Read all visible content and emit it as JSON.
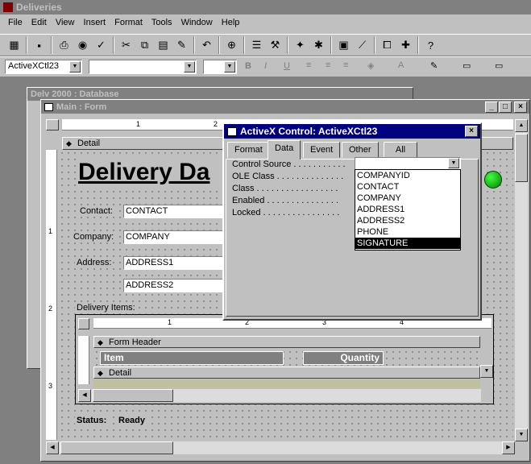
{
  "app": {
    "title": "Deliveries"
  },
  "menu": [
    "File",
    "Edit",
    "View",
    "Insert",
    "Format",
    "Tools",
    "Window",
    "Help"
  ],
  "format_bar": {
    "object_combo": "ActiveXCtl23",
    "font_combo": "",
    "size_combo": ""
  },
  "toolbar_icons": [
    "form-view-icon",
    "save-icon",
    "print-icon",
    "print-preview-icon",
    "spelling-icon",
    "cut-icon",
    "copy-icon",
    "paste-icon",
    "format-painter-icon",
    "undo-icon",
    "insert-hyperlink-icon",
    "field-list-icon",
    "toolbox-icon",
    "autoformat-icon",
    "code-icon",
    "properties-icon",
    "build-icon",
    "database-window-icon",
    "new-object-icon",
    "help-icon"
  ],
  "back_window": {
    "title": "Delv 2000 : Database"
  },
  "form_window": {
    "title": "Main : Form"
  },
  "form": {
    "detail_label": "Detail",
    "heading": "Delivery Da",
    "contact_label": "Contact:",
    "contact_field": "CONTACT",
    "company_label": "Company:",
    "company_field": "COMPANY",
    "address_label": "Address:",
    "address1_field": "ADDRESS1",
    "address2_field": "ADDRESS2",
    "delivery_items_label": "Delivery Items:",
    "sub_form_header_label": "Form Header",
    "sub_item_header": "Item",
    "sub_quantity_header": "Quantity",
    "sub_detail_label": "Detail",
    "status_label": "Status:",
    "status_value": "Ready",
    "ruler_marks": [
      "1",
      "2"
    ],
    "subform_ruler_marks": [
      "1",
      "2",
      "3",
      "4"
    ],
    "vruler_marks": [
      "1",
      "2",
      "3"
    ]
  },
  "properties_dialog": {
    "title": "ActiveX Control: ActiveXCtl23",
    "tabs": [
      "Format",
      "Data",
      "Event",
      "Other",
      "All"
    ],
    "active_tab": "Data",
    "properties": [
      "Control Source . . . . . . . . . . .",
      "OLE Class . . . . . . . . . . . . . .",
      "Class . . . . . . . . . . . . . . . . .",
      "Enabled . . . . . . . . . . . . . . .",
      "Locked . . . . . . . . . . . . . . . ."
    ],
    "control_source_value": "",
    "dropdown_options": [
      "COMPANYID",
      "CONTACT",
      "COMPANY",
      "ADDRESS1",
      "ADDRESS2",
      "PHONE",
      "SIGNATURE"
    ],
    "selected_option": "SIGNATURE"
  }
}
